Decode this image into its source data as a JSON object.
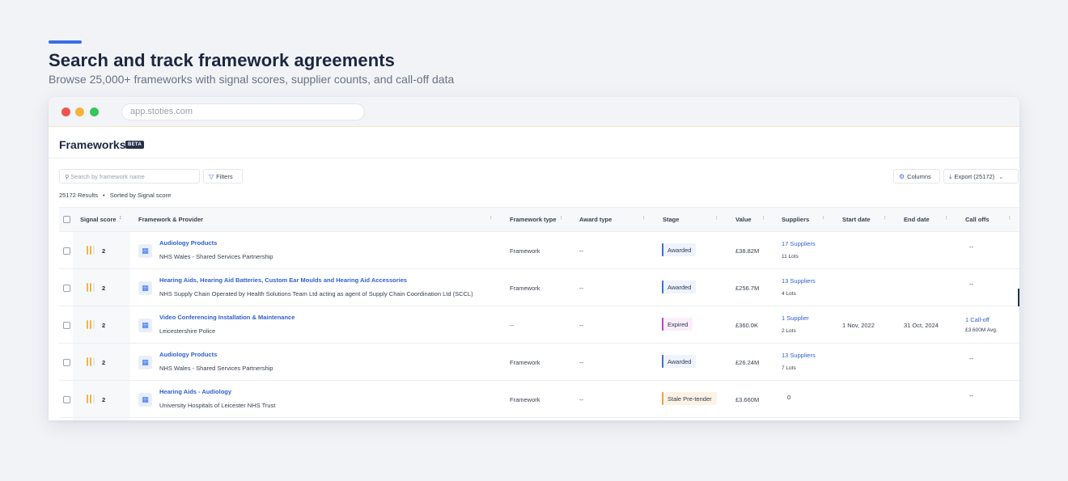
{
  "hero": {
    "title": "Search and track framework agreements",
    "subtitle": "Browse 25,000+ frameworks with signal scores, supplier counts, and call-off data"
  },
  "browser": {
    "url": "app.stoties.com"
  },
  "page": {
    "title": "Frameworks",
    "badge": "BETA"
  },
  "toolbar": {
    "search_placeholder": "Search by framework name",
    "filters_label": "Filters",
    "columns_label": "Columns",
    "export_label": "Export (25172)"
  },
  "results": {
    "count": "25172 Results",
    "separator": "•",
    "sort": "Sorted by Signal score"
  },
  "table": {
    "headers": {
      "signal": "Signal score",
      "framework": "Framework & Provider",
      "type": "Framework type",
      "award": "Award type",
      "stage": "Stage",
      "value": "Value",
      "suppliers": "Suppliers",
      "start": "Start date",
      "end": "End date",
      "calloffs": "Call offs"
    },
    "rows": [
      {
        "signal": "2",
        "name": "Audiology Products",
        "provider": "NHS Wales - Shared Services Partnership",
        "type": "Framework",
        "award": "--",
        "stage": "Awarded",
        "value": "£38.82M",
        "suppliers": "17 Suppliers",
        "lots": "11 Lots",
        "start": "",
        "end": "",
        "calloffs": "--",
        "calloffs_avg": ""
      },
      {
        "signal": "2",
        "name": "Hearing Aids, Hearing Aid Batteries, Custom Ear Moulds and Hearing Aid Accessories",
        "provider": "NHS Supply Chain Operated by Health Solutions Team Ltd acting as agent of Supply Chain Coordination Ltd (SCCL)",
        "type": "Framework",
        "award": "--",
        "stage": "Awarded",
        "value": "£256.7M",
        "suppliers": "13 Suppliers",
        "lots": "4 Lots",
        "start": "",
        "end": "",
        "calloffs": "--",
        "calloffs_avg": ""
      },
      {
        "signal": "2",
        "name": "Video Conferencing Installation & Maintenance",
        "provider": "Leicestershire Police",
        "type": "--",
        "award": "--",
        "stage": "Expired",
        "value": "£360.0K",
        "suppliers": "1 Supplier",
        "lots": "2 Lots",
        "start": "1 Nov, 2022",
        "end": "31 Oct, 2024",
        "calloffs": "1 Call-off",
        "calloffs_avg": "£3.600M Avg."
      },
      {
        "signal": "2",
        "name": "Audiology Products",
        "provider": "NHS Wales - Shared Services Partnership",
        "type": "Framework",
        "award": "--",
        "stage": "Awarded",
        "value": "£26.24M",
        "suppliers": "13 Suppliers",
        "lots": "7 Lots",
        "start": "",
        "end": "",
        "calloffs": "--",
        "calloffs_avg": ""
      },
      {
        "signal": "2",
        "name": "Hearing Aids - Audiology",
        "provider": "University Hospitals of Leicester NHS Trust",
        "type": "Framework",
        "award": "--",
        "stage": "Stale Pre-tender",
        "value": "£3.660M",
        "suppliers": "0",
        "lots": "",
        "start": "",
        "end": "",
        "calloffs": "--",
        "calloffs_avg": ""
      }
    ]
  },
  "colors": {
    "accent": "#3a6ee8",
    "link": "#2f5fd0",
    "stage_awarded": "#3a6ee8",
    "stage_expired": "#c53ec7",
    "stage_stale": "#f0a23a",
    "signal_bar": "#f4b43a"
  },
  "icons": {
    "search": "search-icon",
    "filters": "filter-icon",
    "columns": "gear-icon",
    "export": "download-icon",
    "framework": "grid-icon",
    "sort": "sort-icon"
  }
}
